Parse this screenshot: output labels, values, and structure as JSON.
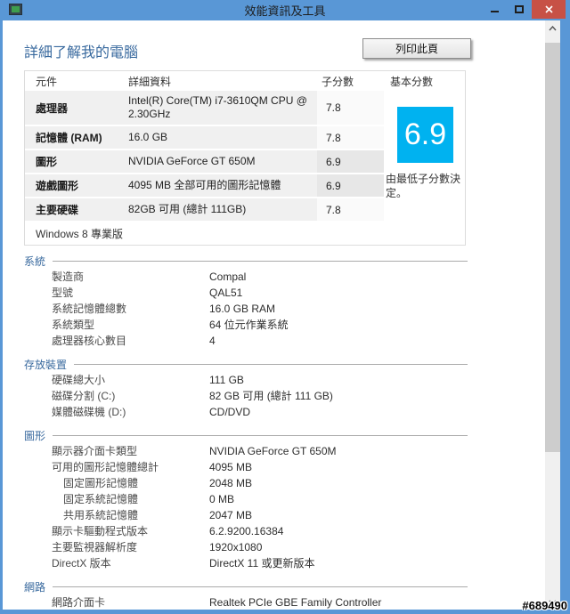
{
  "window": {
    "title": "效能資訊及工具",
    "watermark": "#689490"
  },
  "colors": {
    "titlebar": "#5997d6",
    "close_button": "#c75146",
    "score_box": "#00b2f0",
    "accent": "#38699e"
  },
  "page": {
    "heading": "詳細了解我的電腦",
    "print_button": "列印此頁"
  },
  "score_table": {
    "headers": {
      "component": "元件",
      "details": "詳細資料",
      "subscore": "子分數",
      "base_score": "基本分數"
    },
    "rows": [
      {
        "component": "處理器",
        "details": "Intel(R) Core(TM) i7-3610QM CPU @ 2.30GHz",
        "subscore": "7.8",
        "lowest": false
      },
      {
        "component": "記憶體 (RAM)",
        "details": "16.0 GB",
        "subscore": "7.8",
        "lowest": false
      },
      {
        "component": "圖形",
        "details": "NVIDIA GeForce GT 650M",
        "subscore": "6.9",
        "lowest": true
      },
      {
        "component": "遊戲圖形",
        "details": "4095 MB 全部可用的圖形記憶體",
        "subscore": "6.9",
        "lowest": true
      },
      {
        "component": "主要硬碟",
        "details": "82GB 可用 (總計 111GB)",
        "subscore": "7.8",
        "lowest": false
      }
    ],
    "base_score": {
      "value": "6.9",
      "note": "由最低子分數決定。"
    },
    "os_edition": "Windows 8 專業版"
  },
  "sections": [
    {
      "title": "系統",
      "rows": [
        {
          "label": "製造商",
          "value": "Compal",
          "indent": false
        },
        {
          "label": "型號",
          "value": "QAL51",
          "indent": false
        },
        {
          "label": "系統記憶體總數",
          "value": "16.0 GB RAM",
          "indent": false
        },
        {
          "label": "系統類型",
          "value": "64 位元作業系統",
          "indent": false
        },
        {
          "label": "處理器核心數目",
          "value": "4",
          "indent": false
        }
      ]
    },
    {
      "title": "存放裝置",
      "rows": [
        {
          "label": "硬碟總大小",
          "value": "111 GB",
          "indent": false
        },
        {
          "label": "磁碟分割 (C:)",
          "value": "82 GB 可用 (總計 111 GB)",
          "indent": false
        },
        {
          "label": "媒體磁碟機 (D:)",
          "value": "CD/DVD",
          "indent": false
        }
      ]
    },
    {
      "title": "圖形",
      "rows": [
        {
          "label": "顯示器介面卡類型",
          "value": "NVIDIA GeForce GT 650M",
          "indent": false
        },
        {
          "label": "可用的圖形記憶體總計",
          "value": "4095 MB",
          "indent": false
        },
        {
          "label": "固定圖形記憶體",
          "value": "2048 MB",
          "indent": true
        },
        {
          "label": "固定系統記憶體",
          "value": "0 MB",
          "indent": true
        },
        {
          "label": "共用系統記憶體",
          "value": "2047 MB",
          "indent": true
        },
        {
          "label": "顯示卡驅動程式版本",
          "value": "6.2.9200.16384",
          "indent": false
        },
        {
          "label": "主要監視器解析度",
          "value": "1920x1080",
          "indent": false
        },
        {
          "label": "DirectX 版本",
          "value": "DirectX 11 或更新版本",
          "indent": false
        }
      ]
    },
    {
      "title": "網路",
      "rows": [
        {
          "label": "網路介面卡",
          "value": "Realtek PCIe GBE Family Controller",
          "indent": false
        }
      ]
    }
  ]
}
